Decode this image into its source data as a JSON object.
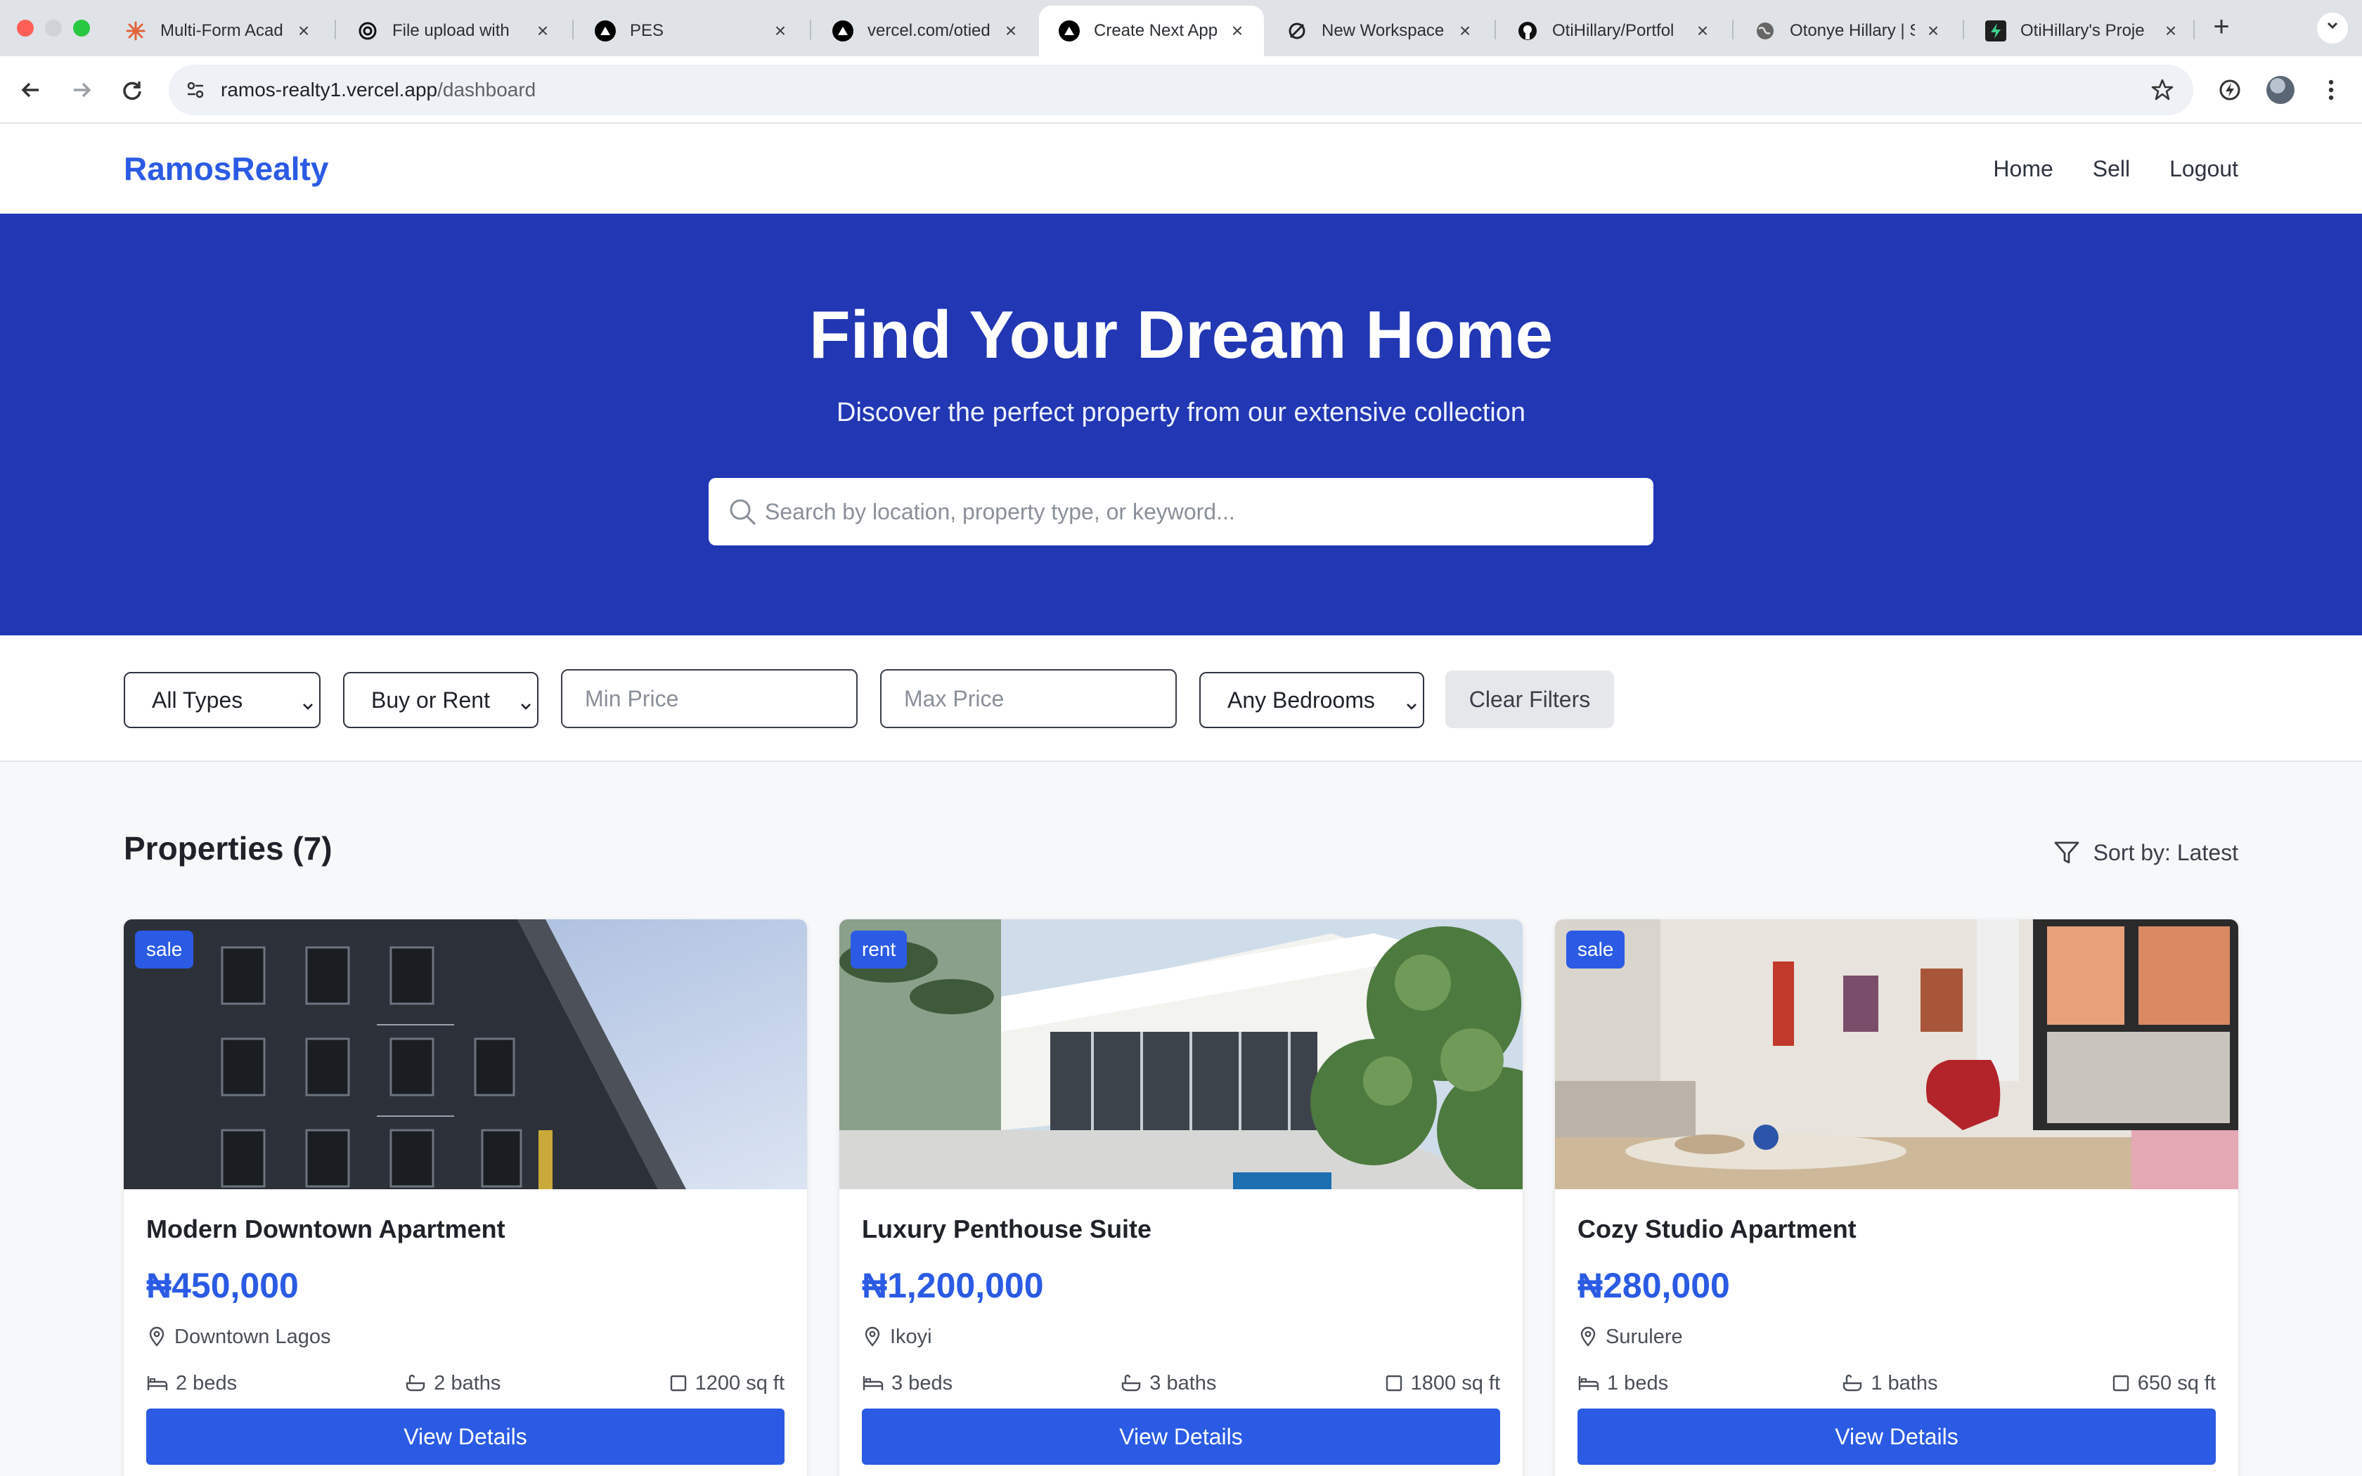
{
  "browser": {
    "tabs": [
      {
        "label": "Multi-Form Acad",
        "favicon": "sunburst-icon",
        "color": "#e0633a"
      },
      {
        "label": "File upload with",
        "favicon": "openai-icon",
        "color": "#111111"
      },
      {
        "label": "PES",
        "favicon": "vercel-icon",
        "color": "#000000"
      },
      {
        "label": "vercel.com/otied",
        "favicon": "vercel-icon",
        "color": "#000000"
      },
      {
        "label": "Create Next App",
        "favicon": "vercel-icon",
        "color": "#000000",
        "active": true
      },
      {
        "label": "New Workspace",
        "favicon": "workspace-icon",
        "color": "#222222"
      },
      {
        "label": "OtiHillary/Portfol",
        "favicon": "github-icon",
        "color": "#111111"
      },
      {
        "label": "Otonye Hillary | S",
        "favicon": "globe-icon",
        "color": "#555555"
      },
      {
        "label": "OtiHillary's Proje",
        "favicon": "supabase-icon",
        "color": "#1f1f1f"
      }
    ],
    "url_host": "ramos-realty1.vercel.app",
    "url_path": "/dashboard"
  },
  "site": {
    "brand": "RamosRealty",
    "nav": [
      "Home",
      "Sell",
      "Logout"
    ]
  },
  "hero": {
    "title": "Find Your Dream Home",
    "subtitle": "Discover the perfect property from our extensive collection",
    "search_placeholder": "Search by location, property type, or keyword..."
  },
  "filters": {
    "type": "All Types",
    "mode": "Buy or Rent",
    "min_price_placeholder": "Min Price",
    "max_price_placeholder": "Max Price",
    "bedrooms": "Any Bedrooms",
    "clear_label": "Clear Filters"
  },
  "listing": {
    "heading": "Properties (7)",
    "sort_label": "Sort by: Latest",
    "view_label": "View Details",
    "properties": [
      {
        "badge": "sale",
        "name": "Modern Downtown Apartment",
        "price": "₦450,000",
        "location": "Downtown Lagos",
        "beds": "2 beds",
        "baths": "2 baths",
        "area": "1200 sq ft"
      },
      {
        "badge": "rent",
        "name": "Luxury Penthouse Suite",
        "price": "₦1,200,000",
        "location": "Ikoyi",
        "beds": "3 beds",
        "baths": "3 baths",
        "area": "1800 sq ft"
      },
      {
        "badge": "sale",
        "name": "Cozy Studio Apartment",
        "price": "₦280,000",
        "location": "Surulere",
        "beds": "1 beds",
        "baths": "1 baths",
        "area": "650 sq ft"
      }
    ]
  },
  "colors": {
    "brand": "#2b5be4",
    "hero_bg": "#2137b4"
  }
}
